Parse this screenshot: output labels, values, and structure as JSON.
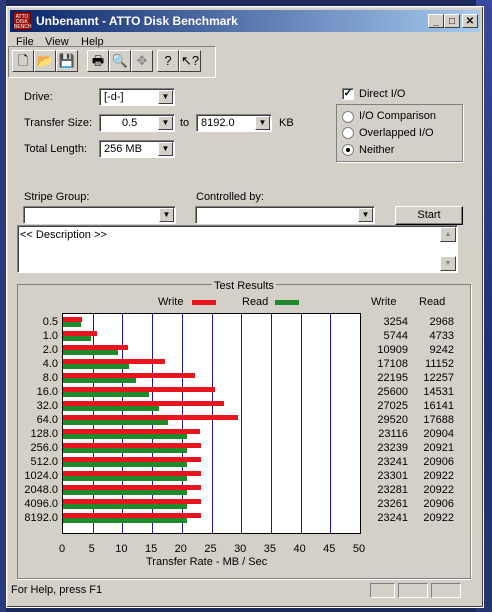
{
  "window": {
    "title": "Unbenannt - ATTO Disk Benchmark",
    "app_icon_text": "ATTO\nDISK\nBENCH"
  },
  "menu": [
    "File",
    "View",
    "Help"
  ],
  "toolbar": {
    "icons": [
      "new-file-icon",
      "open-folder-icon",
      "save-icon",
      "print-icon",
      "print-preview-icon",
      "move-icon",
      "help-icon",
      "context-help-icon"
    ]
  },
  "form": {
    "drive_label": "Drive:",
    "drive_value": "[-d-]",
    "transfer_size_label": "Transfer Size:",
    "transfer_from": "0.5",
    "to_label": "to",
    "transfer_to": "8192.0",
    "kb_label": "KB",
    "total_length_label": "Total Length:",
    "total_length_value": "256 MB",
    "direct_io_label": "Direct I/O",
    "direct_io_checked": true,
    "io_comparison_label": "I/O Comparison",
    "overlapped_io_label": "Overlapped I/O",
    "neither_label": "Neither",
    "selected_mode": "neither",
    "stripe_group_label": "Stripe Group:",
    "controlled_by_label": "Controlled by:",
    "start_label": "Start",
    "description": "<< Description >>"
  },
  "results": {
    "group_label": "Test Results",
    "write_label": "Write",
    "read_label": "Read",
    "write_color": "#e8141e",
    "read_color": "#1f8a2a",
    "col_write_header": "Write",
    "col_read_header": "Read",
    "x_label": "Transfer Rate - MB / Sec"
  },
  "chart_data": {
    "type": "bar",
    "orientation": "horizontal",
    "categories": [
      "0.5",
      "1.0",
      "2.0",
      "4.0",
      "8.0",
      "16.0",
      "32.0",
      "64.0",
      "128.0",
      "256.0",
      "512.0",
      "1024.0",
      "2048.0",
      "4096.0",
      "8192.0"
    ],
    "series": [
      {
        "name": "Write",
        "values": [
          3254,
          5744,
          10909,
          17108,
          22195,
          25600,
          27025,
          29520,
          23116,
          23239,
          23241,
          23301,
          23281,
          23261,
          23241
        ]
      },
      {
        "name": "Read",
        "values": [
          2968,
          4733,
          9242,
          11152,
          12257,
          14531,
          16141,
          17688,
          20904,
          20921,
          20906,
          20922,
          20922,
          20906,
          20922
        ]
      }
    ],
    "xlim": [
      0,
      50
    ],
    "xticks": [
      "0",
      "5",
      "10",
      "15",
      "20",
      "25",
      "30",
      "35",
      "40",
      "45",
      "50"
    ],
    "xlabel": "Transfer Rate - MB / Sec",
    "grid": true
  },
  "status": {
    "text": "For Help, press F1"
  }
}
